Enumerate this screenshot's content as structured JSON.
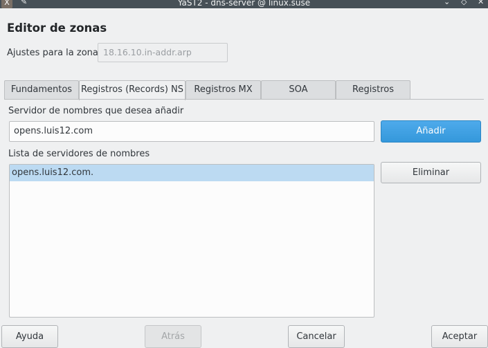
{
  "window": {
    "title": "YaST2 - dns-server @ linux.suse",
    "app_icon_glyph": "X",
    "pin_glyph": "✎",
    "minimize_glyph": "⌄",
    "maximize_glyph": "◇",
    "close_glyph": "✕"
  },
  "header": {
    "title": "Editor de zonas"
  },
  "zone": {
    "label": "Ajustes para la zona",
    "value": "18.16.10.in-addr.arp"
  },
  "tabs": [
    {
      "label": "Fundamentos",
      "active": false
    },
    {
      "label": "Registros (Records) NS",
      "active": true
    },
    {
      "label": "Registros MX",
      "active": false
    },
    {
      "label": "SOA",
      "active": false
    },
    {
      "label": "Registros",
      "active": false
    }
  ],
  "ns_panel": {
    "add_label": "Servidor de nombres que desea añadir",
    "add_value": "opens.luis12.com",
    "add_button": "Añadir",
    "list_label": "Lista de servidores de nombres",
    "servers": [
      {
        "name": "opens.luis12.com.",
        "selected": true
      }
    ],
    "remove_button": "Eliminar"
  },
  "footer": {
    "help": "Ayuda",
    "back": "Atrás",
    "cancel": "Cancelar",
    "accept": "Aceptar"
  },
  "colors": {
    "accent": "#3498db",
    "selection": "#bcdaf2",
    "titlebar": "#475057",
    "background": "#eff0f1"
  }
}
